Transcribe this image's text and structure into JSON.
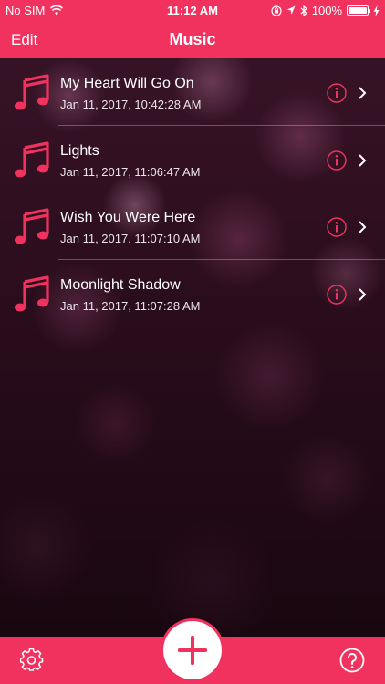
{
  "status_bar": {
    "carrier": "No SIM",
    "time": "11:12 AM",
    "battery": "100%",
    "icons": [
      "wifi-icon",
      "orientation-lock-icon",
      "location-icon",
      "bluetooth-icon",
      "battery-icon",
      "charging-icon"
    ]
  },
  "nav": {
    "edit_label": "Edit",
    "title": "Music"
  },
  "songs": [
    {
      "title": "My Heart Will Go On",
      "date": "Jan 11, 2017, 10:42:28 AM"
    },
    {
      "title": "Lights",
      "date": "Jan 11, 2017, 11:06:47 AM"
    },
    {
      "title": "Wish You Were Here",
      "date": "Jan 11, 2017, 11:07:10 AM"
    },
    {
      "title": "Moonlight Shadow",
      "date": "Jan 11, 2017, 11:07:28 AM"
    }
  ],
  "tabbar": {
    "icons": [
      "settings-icon",
      "add-icon",
      "help-icon"
    ]
  },
  "colors": {
    "accent": "#f2325e",
    "icon_pink": "#f2325e",
    "text": "#ffffff"
  }
}
